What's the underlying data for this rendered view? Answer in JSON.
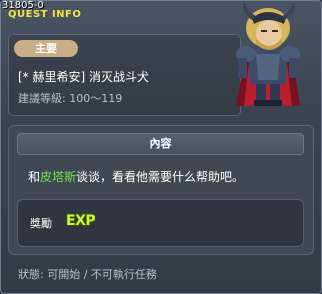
{
  "window": {
    "quest_id": "31805-0",
    "title": "QUEST INFO"
  },
  "quest": {
    "category_badge": "主要",
    "name": "[* 赫里希安] 消灭战斗犬",
    "level_label": "建議等級: 100～119"
  },
  "content": {
    "header": "內容",
    "desc_prefix": "和",
    "desc_npc": "皮塔斯",
    "desc_suffix": "谈谈，看看他需要什么帮助吧。",
    "npc_color": "#6fe24e"
  },
  "reward": {
    "label": "獎勵",
    "item_icon": "exp-icon",
    "item_text": "EXP"
  },
  "status": {
    "text": "狀態: 可開始 / 不可執行任務"
  },
  "colors": {
    "title_yellow": "#f2e24a",
    "badge_tan": "#c9ad85",
    "panel": "#3f4853"
  }
}
